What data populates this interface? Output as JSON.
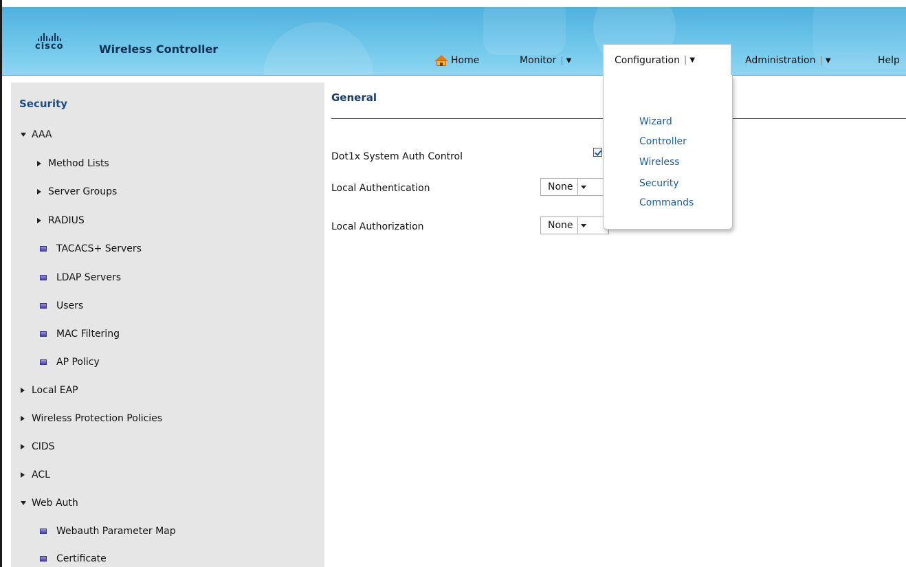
{
  "header": {
    "logo_word": "cisco",
    "app_title": "Wireless Controller",
    "nav": {
      "home": "Home",
      "monitor": "Monitor",
      "configuration": "Configuration",
      "administration": "Administration",
      "help": "Help"
    },
    "separator": "|",
    "caret": "▼"
  },
  "dropdown": {
    "items": [
      "Wizard",
      "Controller",
      "Wireless",
      "Security",
      "Commands"
    ]
  },
  "sidebar": {
    "title": "Security",
    "items": [
      {
        "label": "AAA",
        "marker": "expanded"
      },
      {
        "label": "Method Lists",
        "marker": "collapsed"
      },
      {
        "label": "Server Groups",
        "marker": "collapsed"
      },
      {
        "label": "RADIUS",
        "marker": "collapsed"
      },
      {
        "label": "TACACS+ Servers",
        "marker": "leaf"
      },
      {
        "label": "LDAP Servers",
        "marker": "leaf"
      },
      {
        "label": "Users",
        "marker": "leaf"
      },
      {
        "label": "MAC Filtering",
        "marker": "leaf"
      },
      {
        "label": "AP Policy",
        "marker": "leaf"
      },
      {
        "label": "Local EAP",
        "marker": "collapsed"
      },
      {
        "label": "Wireless Protection Policies",
        "marker": "collapsed"
      },
      {
        "label": "CIDS",
        "marker": "collapsed"
      },
      {
        "label": "ACL",
        "marker": "collapsed"
      },
      {
        "label": "Web Auth",
        "marker": "expanded"
      },
      {
        "label": "Webauth Parameter Map",
        "marker": "leaf"
      },
      {
        "label": "Certificate",
        "marker": "leaf"
      }
    ]
  },
  "content": {
    "title": "General",
    "fields": {
      "dot1x_label": "Dot1x System Auth Control",
      "dot1x_checked": true,
      "local_auth_label": "Local Authentication",
      "local_auth_value": "None",
      "local_authz_label": "Local Authorization",
      "local_authz_value": "None"
    }
  },
  "colors": {
    "header": "#6ec6ea",
    "brand_navy": "#0c2f54",
    "link_blue": "#1b5e9a",
    "sidebar_bg": "#e6e6e6"
  }
}
